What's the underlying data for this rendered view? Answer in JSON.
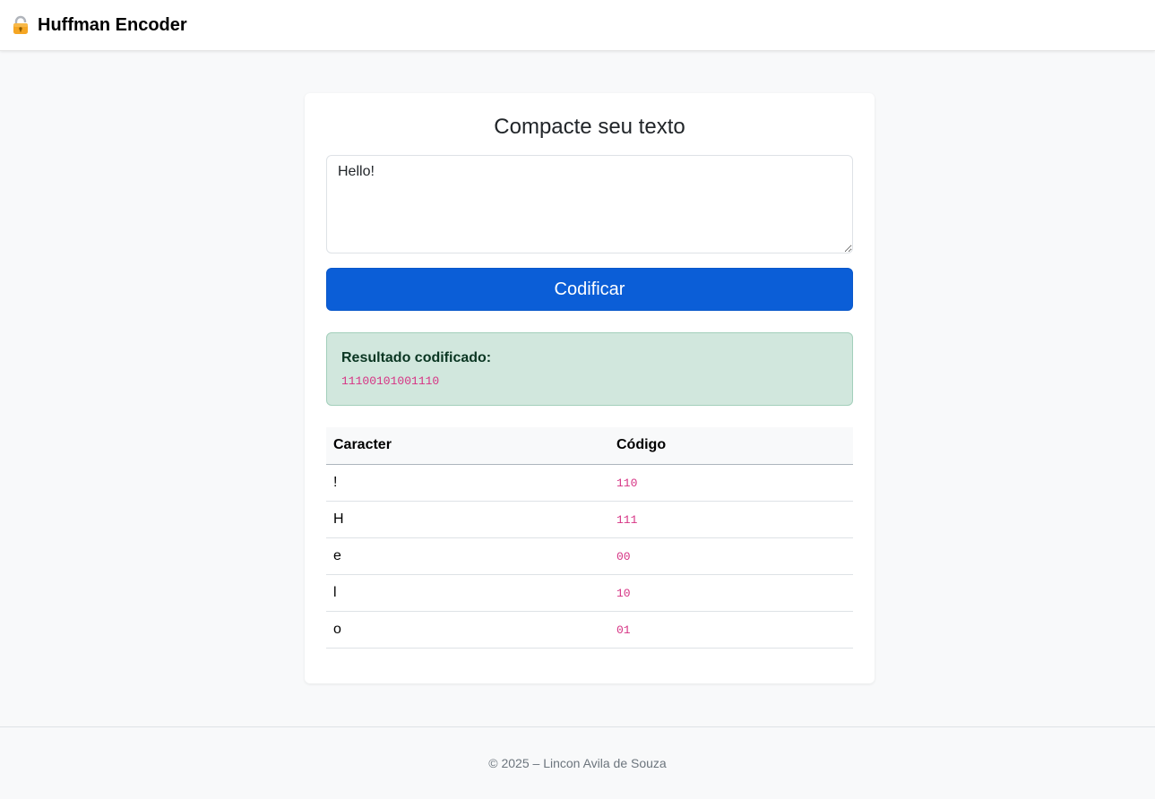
{
  "header": {
    "icon": "lock-icon",
    "title": "Huffman Encoder"
  },
  "main": {
    "title": "Compacte seu texto",
    "input_value": "Hello!",
    "button_label": "Codificar",
    "result": {
      "label": "Resultado codificado:",
      "value": "11100101001110"
    },
    "table": {
      "headers": [
        "Caracter",
        "Código"
      ],
      "rows": [
        {
          "char": "!",
          "code": "110"
        },
        {
          "char": "H",
          "code": "111"
        },
        {
          "char": "e",
          "code": "00"
        },
        {
          "char": "l",
          "code": "10"
        },
        {
          "char": "o",
          "code": "01"
        }
      ]
    }
  },
  "footer": {
    "text": "© 2025 – Lincon Avila de Souza"
  },
  "colors": {
    "primary": "#0b5ed7",
    "success_bg": "#d1e7dd",
    "code": "#d63384"
  }
}
